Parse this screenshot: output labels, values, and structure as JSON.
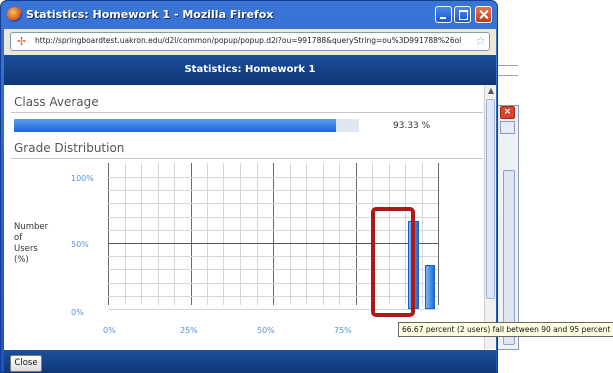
{
  "window": {
    "title": "Statistics: Homework 1 - Mozilla Firefox",
    "url": "http://springboardtest.uakron.edu/d2l/common/popup/popup.d2l?ou=991788&queryString=ou%3D991788%26ol"
  },
  "popup": {
    "title": "Statistics: Homework 1"
  },
  "class_average": {
    "heading": "Class Average",
    "value_text": "93.33 %",
    "value": 93.33
  },
  "grade_distribution": {
    "heading": "Grade Distribution",
    "ylabel_lines": [
      "Number",
      "of",
      "Users",
      "(%)"
    ],
    "ytick_labels": [
      "100%",
      "50%",
      "0%"
    ],
    "xtick_labels": [
      "0%",
      "25%",
      "50%",
      "75%"
    ]
  },
  "chart_data": {
    "type": "bar",
    "title": "Grade Distribution",
    "xlabel": "",
    "ylabel": "Number of Users (%)",
    "ylim": [
      0,
      100
    ],
    "xlim": [
      0,
      100
    ],
    "x_ticks": [
      0,
      25,
      50,
      75
    ],
    "bars": [
      {
        "range": [
          90,
          95
        ],
        "value": 66.67
      },
      {
        "range": [
          95,
          100
        ],
        "value": 33.33
      }
    ],
    "grid": true
  },
  "tooltip": {
    "text": "66.67 percent (2 users) fall between 90 and 95 percent"
  },
  "footer": {
    "close_label": "Close"
  },
  "colors": {
    "titlebar": "#2f67d0",
    "popup_header": "#123f85",
    "bar": "#2b7ae4",
    "highlight": "#b01818"
  }
}
